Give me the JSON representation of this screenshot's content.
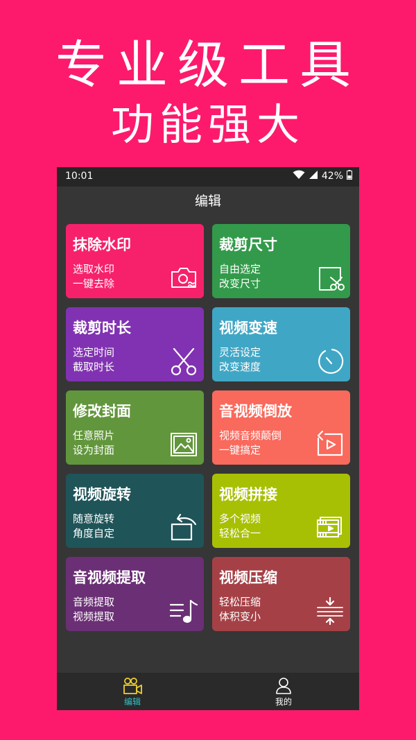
{
  "promo": {
    "headline": "专业级工具",
    "subheadline": "功能强大"
  },
  "status_bar": {
    "time": "10:01",
    "battery": "42%"
  },
  "header": {
    "title": "编辑"
  },
  "cards": [
    {
      "title": "抹除水印",
      "line1": "选取水印",
      "line2": "一键去除",
      "color": "#f7216b",
      "icon": "camera-icon"
    },
    {
      "title": "裁剪尺寸",
      "line1": "自由选定",
      "line2": "改变尺寸",
      "color": "#329a4a",
      "icon": "crop-scissors-icon"
    },
    {
      "title": "裁剪时长",
      "line1": "选定时间",
      "line2": "截取时长",
      "color": "#8132b2",
      "icon": "scissors-icon"
    },
    {
      "title": "视频变速",
      "line1": "灵活设定",
      "line2": "改变速度",
      "color": "#40a6c5",
      "icon": "timer-icon"
    },
    {
      "title": "修改封面",
      "line1": "任意照片",
      "line2": "设为封面",
      "color": "#62963c",
      "icon": "image-icon"
    },
    {
      "title": "音视频倒放",
      "line1": "视频音频颠倒",
      "line2": "一键搞定",
      "color": "#f9695c",
      "icon": "replay-icon"
    },
    {
      "title": "视频旋转",
      "line1": "随意旋转",
      "line2": "角度自定",
      "color": "#1f5458",
      "icon": "rotate-icon"
    },
    {
      "title": "视频拼接",
      "line1": "多个视频",
      "line2": "轻松合一",
      "color": "#a8c004",
      "icon": "video-stack-icon"
    },
    {
      "title": "音视频提取",
      "line1": "音频提取",
      "line2": "视频提取",
      "color": "#6b2f75",
      "icon": "music-list-icon"
    },
    {
      "title": "视频压缩",
      "line1": "轻松压缩",
      "line2": "体积变小",
      "color": "#a54146",
      "icon": "compress-icon"
    }
  ],
  "nav": {
    "edit_label": "编辑",
    "mine_label": "我的",
    "active_color": "#2fc0c8",
    "inactive_color": "#ffffff"
  }
}
